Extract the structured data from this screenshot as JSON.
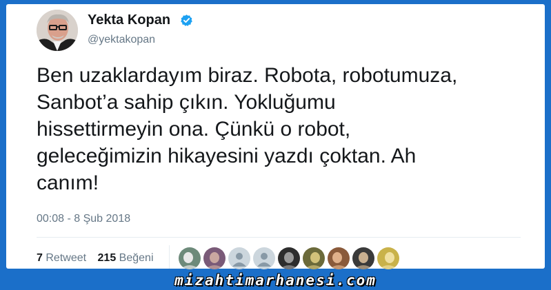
{
  "tweet": {
    "display_name": "Yekta Kopan",
    "handle": "@yektakopan",
    "verified": true,
    "verified_icon": "verified-badge-icon",
    "text": "Ben uzaklardayım biraz. Robota, robotumuza,\nSanbot’a sahip çıkın. Yokluğumu\nhissettirmeyin ona. Çünkü o robot,\ngeleceğimizin hikayesini yazdı çoktan. Ah\ncanım!",
    "timestamp": "00:08 - 8 Şub 2018"
  },
  "stats": {
    "retweet_count": "7",
    "retweet_label": "Retweet",
    "like_count": "215",
    "like_label": "Beğeni"
  },
  "likers": [
    {
      "kind": "photo",
      "bg": "#6d8a7a",
      "fg": "#e8e8e8"
    },
    {
      "kind": "photo",
      "bg": "#7a5a78",
      "fg": "#c9a7a0"
    },
    {
      "kind": "default",
      "bg": "#ccd6dd",
      "fg": "#8899a6"
    },
    {
      "kind": "default",
      "bg": "#ccd6dd",
      "fg": "#8899a6"
    },
    {
      "kind": "photo",
      "bg": "#2d2d2d",
      "fg": "#9a9a9a"
    },
    {
      "kind": "photo",
      "bg": "#6b6a3a",
      "fg": "#d2c27a"
    },
    {
      "kind": "photo",
      "bg": "#8a5a3a",
      "fg": "#e0b08a"
    },
    {
      "kind": "photo",
      "bg": "#3a3a3a",
      "fg": "#c9b090"
    },
    {
      "kind": "photo",
      "bg": "#c9b24a",
      "fg": "#f0e0a0"
    }
  ],
  "watermark": "mizahtimarhanesi.com",
  "colors": {
    "background": "#1b6fc9",
    "card": "#ffffff",
    "text": "#14171a",
    "muted": "#657786",
    "verified": "#1da1f2"
  }
}
